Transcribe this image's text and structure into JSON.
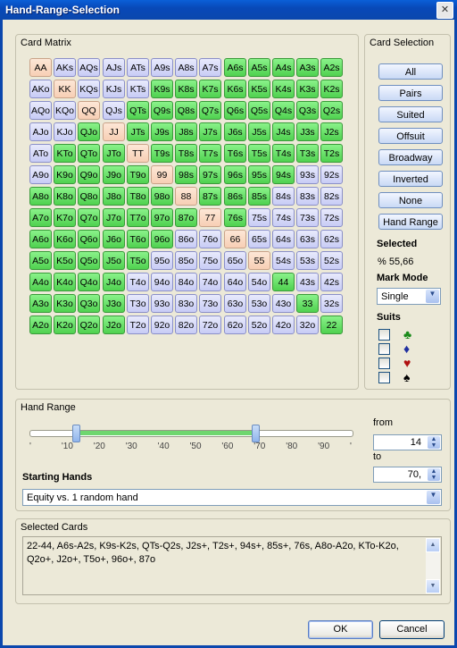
{
  "window": {
    "title": "Hand-Range-Selection",
    "close": "✕"
  },
  "card_matrix": {
    "title": "Card Matrix",
    "rows": [
      [
        "AA",
        "AKs",
        "AQs",
        "AJs",
        "ATs",
        "A9s",
        "A8s",
        "A7s",
        "A6s",
        "A5s",
        "A4s",
        "A3s",
        "A2s"
      ],
      [
        "AKo",
        "KK",
        "KQs",
        "KJs",
        "KTs",
        "K9s",
        "K8s",
        "K7s",
        "K6s",
        "K5s",
        "K4s",
        "K3s",
        "K2s"
      ],
      [
        "AQo",
        "KQo",
        "QQ",
        "QJs",
        "QTs",
        "Q9s",
        "Q8s",
        "Q7s",
        "Q6s",
        "Q5s",
        "Q4s",
        "Q3s",
        "Q2s"
      ],
      [
        "AJo",
        "KJo",
        "QJo",
        "JJ",
        "JTs",
        "J9s",
        "J8s",
        "J7s",
        "J6s",
        "J5s",
        "J4s",
        "J3s",
        "J2s"
      ],
      [
        "ATo",
        "KTo",
        "QTo",
        "JTo",
        "TT",
        "T9s",
        "T8s",
        "T7s",
        "T6s",
        "T5s",
        "T4s",
        "T3s",
        "T2s"
      ],
      [
        "A9o",
        "K9o",
        "Q9o",
        "J9o",
        "T9o",
        "99",
        "98s",
        "97s",
        "96s",
        "95s",
        "94s",
        "93s",
        "92s"
      ],
      [
        "A8o",
        "K8o",
        "Q8o",
        "J8o",
        "T8o",
        "98o",
        "88",
        "87s",
        "86s",
        "85s",
        "84s",
        "83s",
        "82s"
      ],
      [
        "A7o",
        "K7o",
        "Q7o",
        "J7o",
        "T7o",
        "97o",
        "87o",
        "77",
        "76s",
        "75s",
        "74s",
        "73s",
        "72s"
      ],
      [
        "A6o",
        "K6o",
        "Q6o",
        "J6o",
        "T6o",
        "96o",
        "86o",
        "76o",
        "66",
        "65s",
        "64s",
        "63s",
        "62s"
      ],
      [
        "A5o",
        "K5o",
        "Q5o",
        "J5o",
        "T5o",
        "95o",
        "85o",
        "75o",
        "65o",
        "55",
        "54s",
        "53s",
        "52s"
      ],
      [
        "A4o",
        "K4o",
        "Q4o",
        "J4o",
        "T4o",
        "94o",
        "84o",
        "74o",
        "64o",
        "54o",
        "44",
        "43s",
        "42s"
      ],
      [
        "A3o",
        "K3o",
        "Q3o",
        "J3o",
        "T3o",
        "93o",
        "83o",
        "73o",
        "63o",
        "53o",
        "43o",
        "33",
        "32s"
      ],
      [
        "A2o",
        "K2o",
        "Q2o",
        "J2o",
        "T2o",
        "92o",
        "82o",
        "72o",
        "62o",
        "52o",
        "42o",
        "32o",
        "22"
      ]
    ],
    "states": [
      "oBBBBBBBGGGGG",
      "BoBBBGGGGGGGG",
      "BBoBGGGGGGGGG",
      "BBGoGGGGGGGGG",
      "BGGGoGGGGGGGG",
      "BGGGGoGGGGGBB",
      "GGGGGGoGGGBBB",
      "GGGGGGGoGBBBB",
      "GGGGGGBBoBBBB",
      "GGGGGBBBBoBBB",
      "GGGGBBBBBBGBB",
      "GGGGBBBBBBBGB",
      "GGGGBBBBBBBBG"
    ],
    "colors": {
      "green": "#5ad85a",
      "blue": "#c8ccf5",
      "orange": "#f7cfb5"
    }
  },
  "card_selection": {
    "title": "Card Selection",
    "buttons": [
      "All",
      "Pairs",
      "Suited",
      "Offsuit",
      "Broadway",
      "Inverted",
      "None",
      "Hand Range"
    ],
    "selected_label": "Selected",
    "selected_value": "% 55,66",
    "mark_mode_label": "Mark Mode",
    "mark_mode_value": "Single",
    "suits_label": "Suits",
    "suits": [
      {
        "icon": "club-icon",
        "glyph": "♣",
        "color": "#1a8a1a"
      },
      {
        "icon": "diamond-icon",
        "glyph": "♦",
        "color": "#2030a0"
      },
      {
        "icon": "heart-icon",
        "glyph": "♥",
        "color": "#b01010"
      },
      {
        "icon": "spade-icon",
        "glyph": "♠",
        "color": "#000000"
      }
    ]
  },
  "hand_range": {
    "title": "Hand Range",
    "ticks": [
      "'",
      "'10",
      "'20",
      "'30",
      "'40",
      "'50",
      "'60",
      "'70",
      "'80",
      "'90",
      "'"
    ],
    "from_label": "from",
    "from_value": "14",
    "to_label": "to",
    "to_value": "70,",
    "range_from_percent": 14,
    "range_to_percent": 70,
    "starting_hands_label": "Starting Hands",
    "starting_hands_value": "Equity vs. 1 random hand"
  },
  "selected_cards": {
    "title": "Selected Cards",
    "text": "22-44, A6s-A2s, K9s-K2s, QTs-Q2s, J2s+, T2s+, 94s+, 85s+, 76s, A8o-A2o, KTo-K2o, Q2o+, J2o+, T5o+, 96o+, 87o"
  },
  "buttons": {
    "ok": "OK",
    "cancel": "Cancel"
  }
}
